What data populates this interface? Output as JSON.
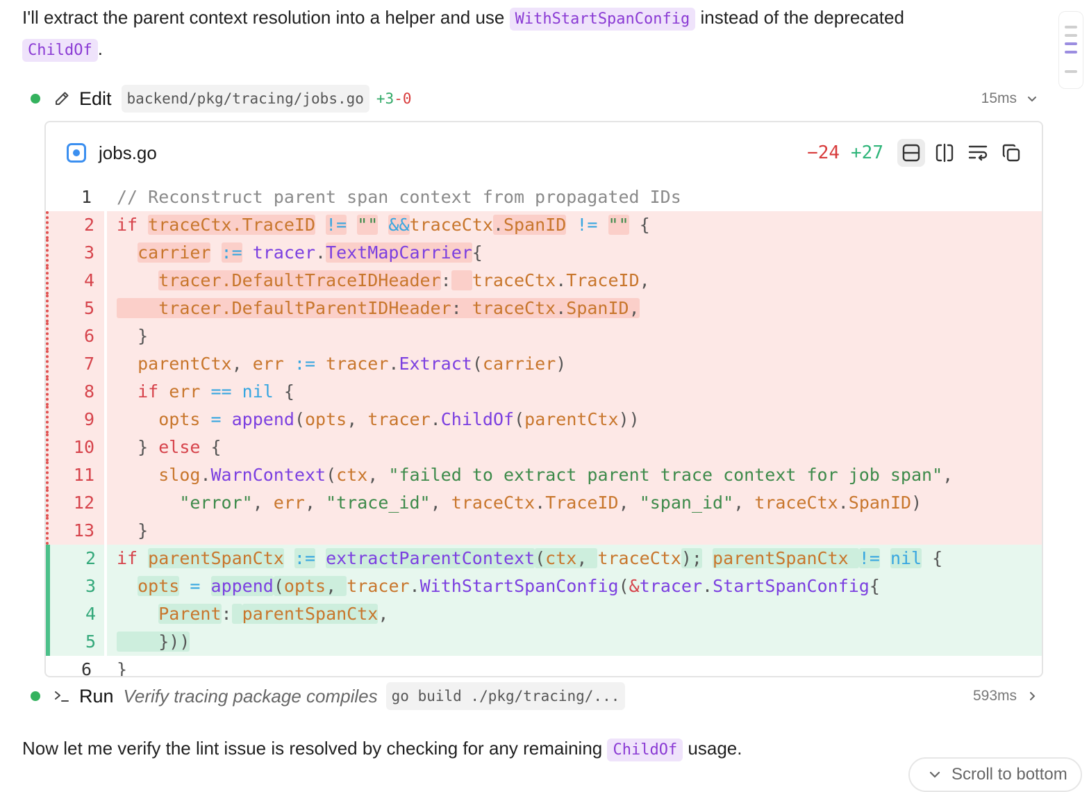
{
  "intro": {
    "text1": "I'll extract the parent context resolution into a helper and use ",
    "chip1": "WithStartSpanConfig",
    "text2": " instead of the deprecated",
    "chip2": "ChildOf",
    "text3": "."
  },
  "edit_tool": {
    "label": "Edit",
    "path": "backend/pkg/tracing/jobs.go",
    "added": "+3",
    "removed": "-0",
    "duration": "15ms",
    "icon": "pencil-icon",
    "status_color": "#34b25e"
  },
  "diff": {
    "file_name": "jobs.go",
    "deletions": "−24",
    "additions": "+27",
    "buttons": [
      "unified-view-icon",
      "split-view-icon",
      "wrap-icon",
      "copy-icon"
    ]
  },
  "run_tool": {
    "label": "Run",
    "description": "Verify tracing package compiles",
    "command": "go build ./pkg/tracing/...",
    "duration": "593ms",
    "icon": "terminal-icon"
  },
  "outro": {
    "text1": "Now let me verify the lint issue is resolved by checking for any remaining ",
    "chip": "ChildOf",
    "text2": " usage."
  },
  "scroll_to_bottom": "Scroll to bottom",
  "colors": {
    "accent_chip_bg": "#efe3fb",
    "accent_chip_text": "#8a3ad4",
    "del_bg": "#fde8e6",
    "add_bg": "#e7f7ee"
  }
}
